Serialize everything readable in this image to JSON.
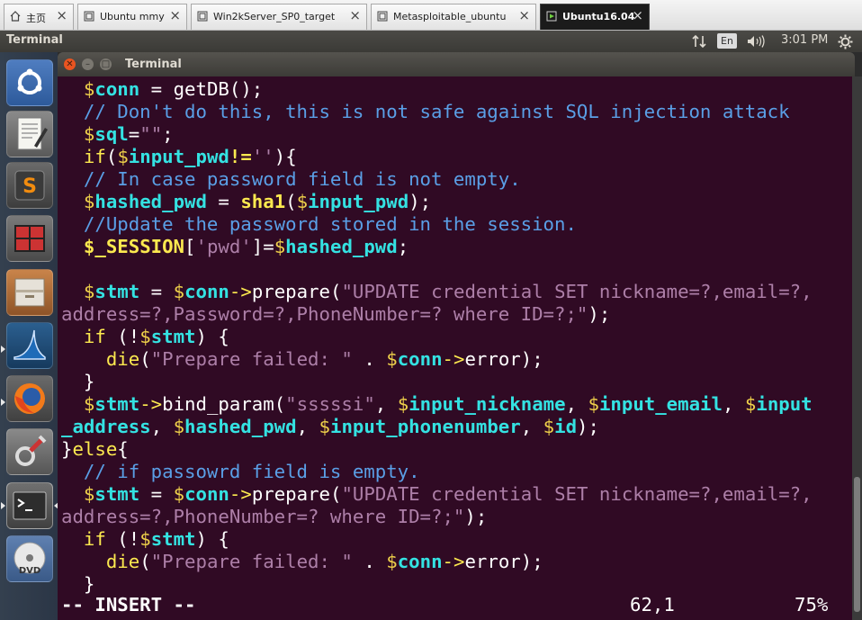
{
  "vm_tabs": [
    {
      "label": "主页",
      "icon": "home-icon",
      "active": false
    },
    {
      "label": "Ubuntu mmy",
      "icon": "vm-icon",
      "active": false
    },
    {
      "label": "Win2kServer_SP0_target",
      "icon": "vm-icon",
      "active": false
    },
    {
      "label": "Metasploitable_ubuntu",
      "icon": "vm-icon",
      "active": false
    },
    {
      "label": "Ubuntu16.04",
      "icon": "vm-running-icon",
      "active": true
    }
  ],
  "panel": {
    "app_title": "Terminal",
    "keyboard_layout": "En",
    "time": "3:01 PM"
  },
  "launcher": {
    "items": [
      "ubuntu-dash-icon",
      "text-editor-icon",
      "sublime-text-icon",
      "workspaces-icon",
      "files-icon",
      "wireshark-icon",
      "firefox-icon",
      "system-settings-icon",
      "terminal-icon",
      "dvd-icon"
    ]
  },
  "window": {
    "title": "Terminal"
  },
  "code_lines": [
    [
      {
        "t": "  "
      },
      {
        "t": "$",
        "c": "v"
      },
      {
        "t": "conn",
        "c": "d"
      },
      {
        "t": " = "
      },
      {
        "t": "getDB"
      },
      {
        "t": "();"
      }
    ],
    [
      {
        "t": "  // Don't do this, this is not safe against SQL injection attack",
        "c": "c"
      }
    ],
    [
      {
        "t": "  "
      },
      {
        "t": "$",
        "c": "v"
      },
      {
        "t": "sql",
        "c": "d"
      },
      {
        "t": "="
      },
      {
        "t": "\"\"",
        "c": "s"
      },
      {
        "t": ";"
      }
    ],
    [
      {
        "t": "  "
      },
      {
        "t": "if",
        "c": "k"
      },
      {
        "t": "("
      },
      {
        "t": "$",
        "c": "v"
      },
      {
        "t": "input_pwd",
        "c": "d"
      },
      {
        "t": "!=",
        "c": "k b"
      },
      {
        "t": "''",
        "c": "s"
      },
      {
        "t": "){"
      }
    ],
    [
      {
        "t": "  // In case password field is not empty.",
        "c": "c"
      }
    ],
    [
      {
        "t": "  "
      },
      {
        "t": "$",
        "c": "v"
      },
      {
        "t": "hashed_pwd",
        "c": "d"
      },
      {
        "t": " = "
      },
      {
        "t": "sha1",
        "c": "k b"
      },
      {
        "t": "("
      },
      {
        "t": "$",
        "c": "v"
      },
      {
        "t": "input_pwd",
        "c": "d"
      },
      {
        "t": ");"
      }
    ],
    [
      {
        "t": "  //Update the password stored in the session.",
        "c": "c"
      }
    ],
    [
      {
        "t": "  "
      },
      {
        "t": "$_SESSION",
        "c": "k b"
      },
      {
        "t": "["
      },
      {
        "t": "'pwd'",
        "c": "s"
      },
      {
        "t": "]="
      },
      {
        "t": "$",
        "c": "v"
      },
      {
        "t": "hashed_pwd",
        "c": "d"
      },
      {
        "t": ";"
      }
    ],
    [
      {
        "t": ""
      }
    ],
    [
      {
        "t": "  "
      },
      {
        "t": "$",
        "c": "v"
      },
      {
        "t": "stmt",
        "c": "d"
      },
      {
        "t": " = "
      },
      {
        "t": "$",
        "c": "v"
      },
      {
        "t": "conn",
        "c": "d"
      },
      {
        "t": "->",
        "c": "k"
      },
      {
        "t": "prepare("
      },
      {
        "t": "\"UPDATE credential SET nickname=?,email=?,",
        "c": "s"
      }
    ],
    [
      {
        "t": "address=?,Password=?,PhoneNumber=? where ID=?;\"",
        "c": "s"
      },
      {
        "t": ");"
      }
    ],
    [
      {
        "t": "  "
      },
      {
        "t": "if",
        "c": "k"
      },
      {
        "t": " (!"
      },
      {
        "t": "$",
        "c": "v"
      },
      {
        "t": "stmt",
        "c": "d"
      },
      {
        "t": ") {"
      }
    ],
    [
      {
        "t": "    "
      },
      {
        "t": "die",
        "c": "k"
      },
      {
        "t": "("
      },
      {
        "t": "\"Prepare failed: \"",
        "c": "s"
      },
      {
        "t": " . "
      },
      {
        "t": "$",
        "c": "v"
      },
      {
        "t": "conn",
        "c": "d"
      },
      {
        "t": "->",
        "c": "k"
      },
      {
        "t": "error);"
      }
    ],
    [
      {
        "t": "  }"
      }
    ],
    [
      {
        "t": "  "
      },
      {
        "t": "$",
        "c": "v"
      },
      {
        "t": "stmt",
        "c": "d"
      },
      {
        "t": "->",
        "c": "k"
      },
      {
        "t": "bind_param("
      },
      {
        "t": "\"sssssi\"",
        "c": "s"
      },
      {
        "t": ", "
      },
      {
        "t": "$",
        "c": "v"
      },
      {
        "t": "input_nickname",
        "c": "d"
      },
      {
        "t": ", "
      },
      {
        "t": "$",
        "c": "v"
      },
      {
        "t": "input_email",
        "c": "d"
      },
      {
        "t": ", "
      },
      {
        "t": "$",
        "c": "v"
      },
      {
        "t": "input",
        "c": "d"
      }
    ],
    [
      {
        "t": "_address",
        "c": "d"
      },
      {
        "t": ", "
      },
      {
        "t": "$",
        "c": "v"
      },
      {
        "t": "hashed_pwd",
        "c": "d"
      },
      {
        "t": ", "
      },
      {
        "t": "$",
        "c": "v"
      },
      {
        "t": "input_phonenumber",
        "c": "d"
      },
      {
        "t": ", "
      },
      {
        "t": "$",
        "c": "v"
      },
      {
        "t": "id",
        "c": "d"
      },
      {
        "t": ");"
      }
    ],
    [
      {
        "t": "}"
      },
      {
        "t": "else",
        "c": "k"
      },
      {
        "t": "{"
      }
    ],
    [
      {
        "t": "  // if passowrd field is empty.",
        "c": "c"
      }
    ],
    [
      {
        "t": "  "
      },
      {
        "t": "$",
        "c": "v"
      },
      {
        "t": "stmt",
        "c": "d"
      },
      {
        "t": " = "
      },
      {
        "t": "$",
        "c": "v"
      },
      {
        "t": "conn",
        "c": "d"
      },
      {
        "t": "->",
        "c": "k"
      },
      {
        "t": "prepare("
      },
      {
        "t": "\"UPDATE credential SET nickname=?,email=?,",
        "c": "s"
      }
    ],
    [
      {
        "t": "address=?,PhoneNumber=? where ID=?;\"",
        "c": "s"
      },
      {
        "t": ");"
      }
    ],
    [
      {
        "t": "  "
      },
      {
        "t": "if",
        "c": "k"
      },
      {
        "t": " (!"
      },
      {
        "t": "$",
        "c": "v"
      },
      {
        "t": "stmt",
        "c": "d"
      },
      {
        "t": ") {"
      }
    ],
    [
      {
        "t": "    "
      },
      {
        "t": "die",
        "c": "k"
      },
      {
        "t": "("
      },
      {
        "t": "\"Prepare failed: \"",
        "c": "s"
      },
      {
        "t": " . "
      },
      {
        "t": "$",
        "c": "v"
      },
      {
        "t": "conn",
        "c": "d"
      },
      {
        "t": "->",
        "c": "k"
      },
      {
        "t": "error);"
      }
    ],
    [
      {
        "t": "  }"
      }
    ]
  ],
  "status": {
    "mode": "-- INSERT --",
    "position": "62,1",
    "percent": "75%"
  },
  "colors": {
    "terminal_bg": "#300a24",
    "variable": "#34e2e2",
    "comment": "#5a9fe6",
    "string": "#ad7fa8",
    "keyword": "#fce94f"
  }
}
